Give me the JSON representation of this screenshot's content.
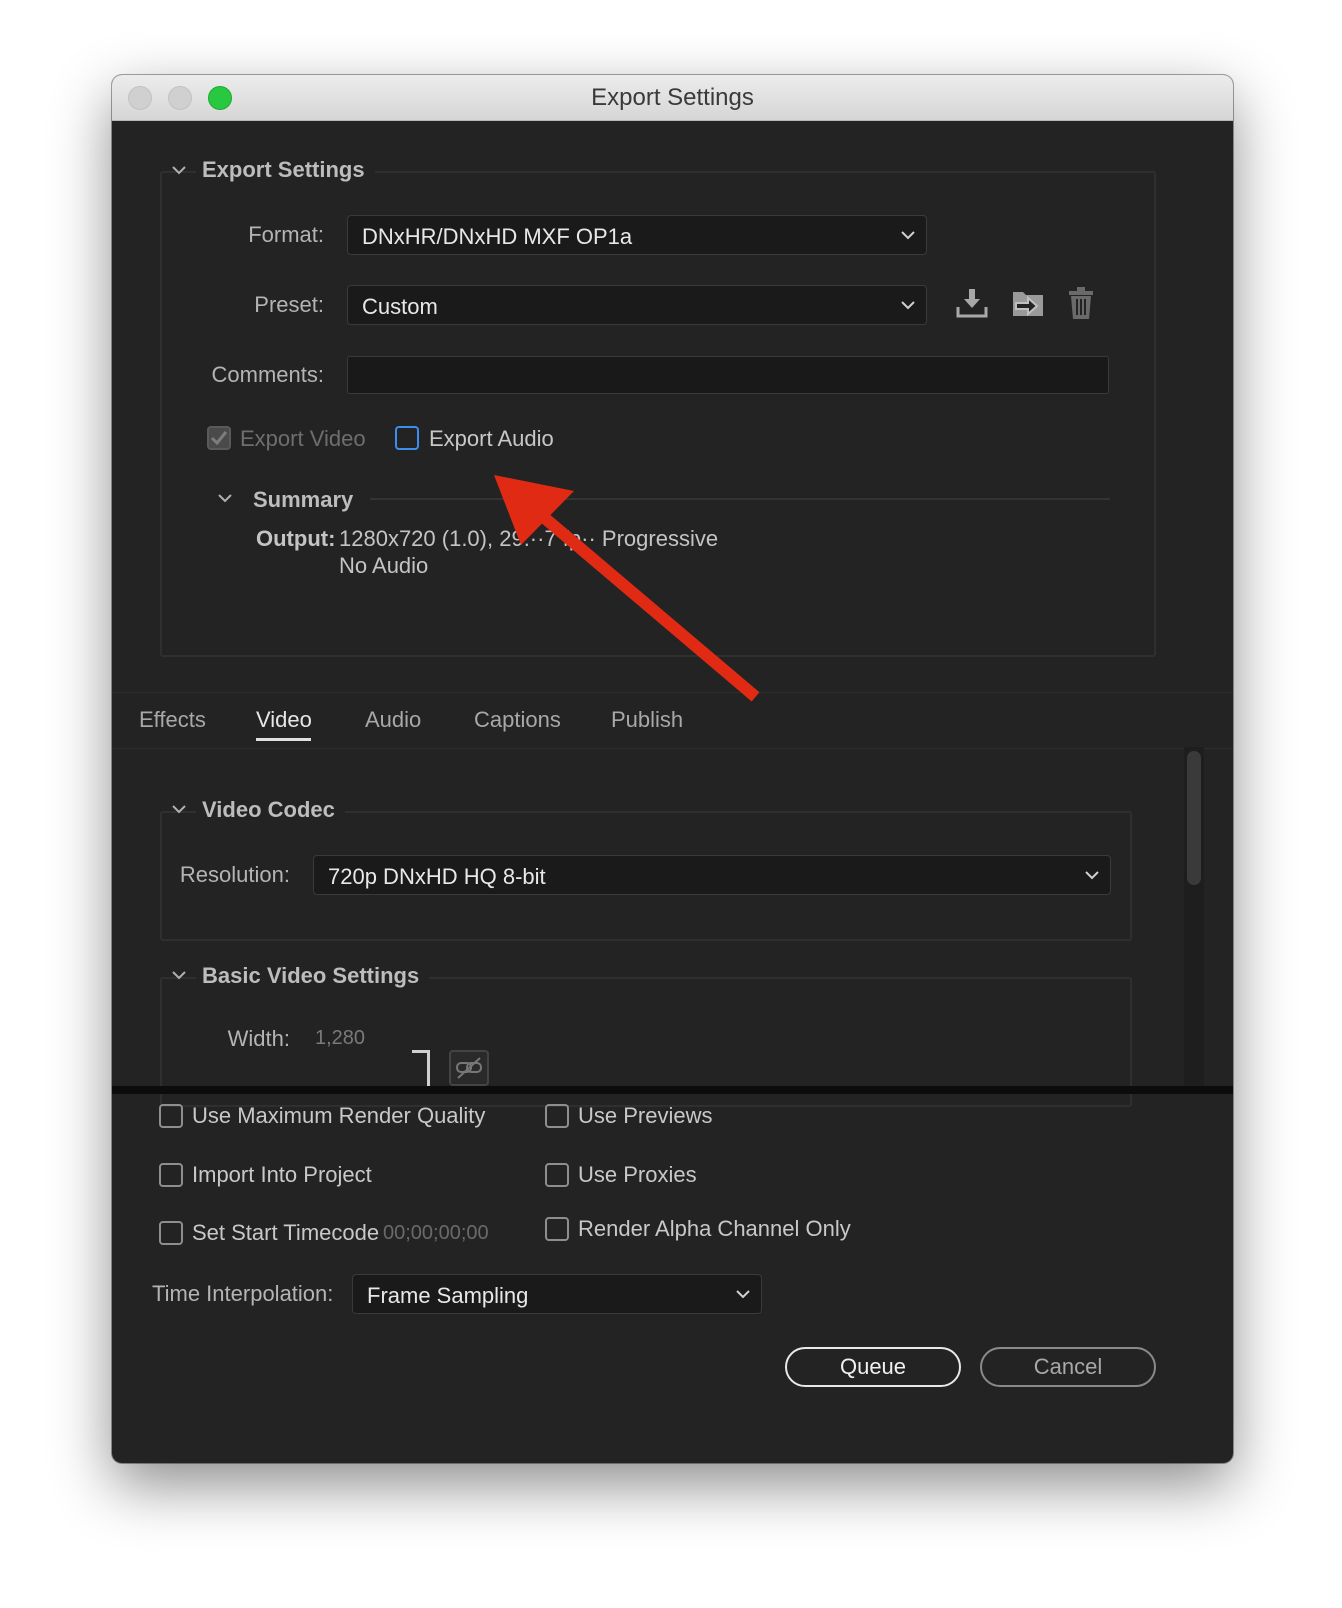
{
  "window": {
    "title": "Export Settings"
  },
  "export_settings": {
    "section_title": "Export Settings",
    "format_label": "Format:",
    "format_value": "DNxHR/DNxHD MXF OP1a",
    "preset_label": "Preset:",
    "preset_value": "Custom",
    "comments_label": "Comments:",
    "comments_value": "",
    "export_video_label": "Export Video",
    "export_video_checked": true,
    "export_audio_label": "Export Audio",
    "export_audio_checked": false
  },
  "summary": {
    "title": "Summary",
    "output_label": "Output:",
    "output_line1": "1280x720 (1.0), 29.··7 fp·· Progressive",
    "output_line2": "No Audio"
  },
  "tabs": [
    {
      "label": "Effects",
      "active": false
    },
    {
      "label": "Video",
      "active": true
    },
    {
      "label": "Audio",
      "active": false
    },
    {
      "label": "Captions",
      "active": false
    },
    {
      "label": "Publish",
      "active": false
    }
  ],
  "video_codec": {
    "title": "Video Codec",
    "resolution_label": "Resolution:",
    "resolution_value": "720p DNxHD HQ 8-bit"
  },
  "basic_video": {
    "title": "Basic Video Settings",
    "width_label": "Width:",
    "width_value": "1,280"
  },
  "options": {
    "max_render_quality": "Use Maximum Render Quality",
    "use_previews": "Use Previews",
    "import_into_project": "Import Into Project",
    "use_proxies": "Use Proxies",
    "set_start_timecode": "Set Start Timecode",
    "start_timecode_value": "00;00;00;00",
    "render_alpha_only": "Render Alpha Channel Only"
  },
  "time_interpolation": {
    "label": "Time Interpolation:",
    "value": "Frame Sampling"
  },
  "buttons": {
    "queue": "Queue",
    "cancel": "Cancel"
  },
  "colors": {
    "annotation_arrow": "#e02a14",
    "focus_blue": "#3b8ef0",
    "traffic_green": "#28c940"
  }
}
